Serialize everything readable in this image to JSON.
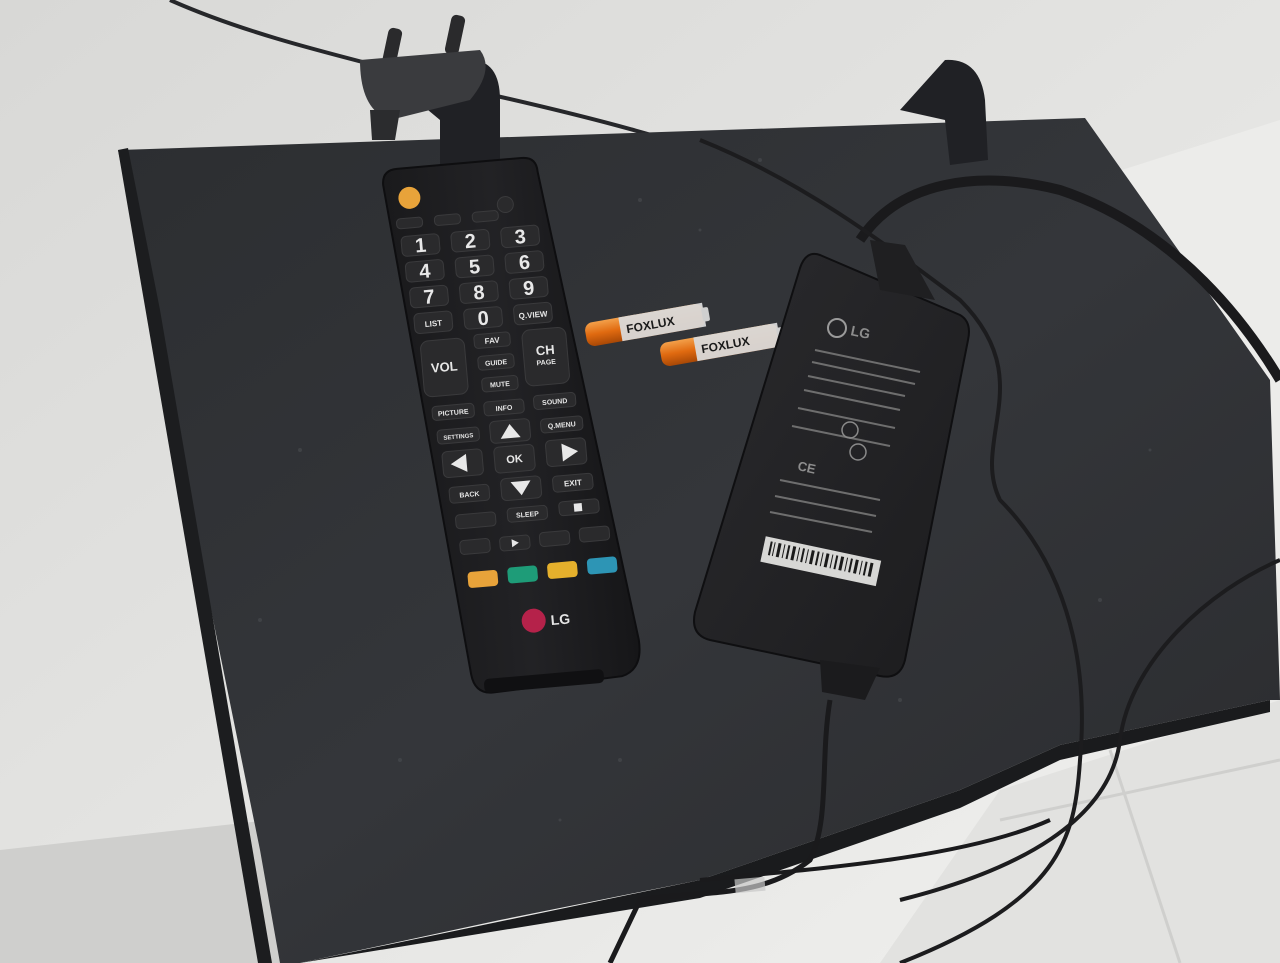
{
  "remote": {
    "brand": "LG",
    "number_keys": [
      "1",
      "2",
      "3",
      "4",
      "5",
      "6",
      "7",
      "8",
      "9",
      "0"
    ],
    "list_label": "LIST",
    "qview_label": "Q.VIEW",
    "fav_label": "FAV",
    "vol_label": "VOL",
    "ch_label": "CH",
    "page_label": "PAGE",
    "guide_label": "GUIDE",
    "mute_label": "MUTE",
    "picture_label": "PICTURE",
    "info_label": "INFO",
    "sound_label": "SOUND",
    "settings_label": "SETTINGS",
    "qmenu_label": "Q.MENU",
    "ok_label": "OK",
    "back_label": "BACK",
    "exit_label": "EXIT",
    "sleep_label": "SLEEP",
    "color_keys": [
      "#e8a33a",
      "#1e9c78",
      "#e5b02c",
      "#2d95b5"
    ]
  },
  "batteries": {
    "brand": "FOXLUX",
    "color": "#e06a10"
  },
  "adapter": {
    "brand": "LG",
    "ce_mark": "CE"
  }
}
